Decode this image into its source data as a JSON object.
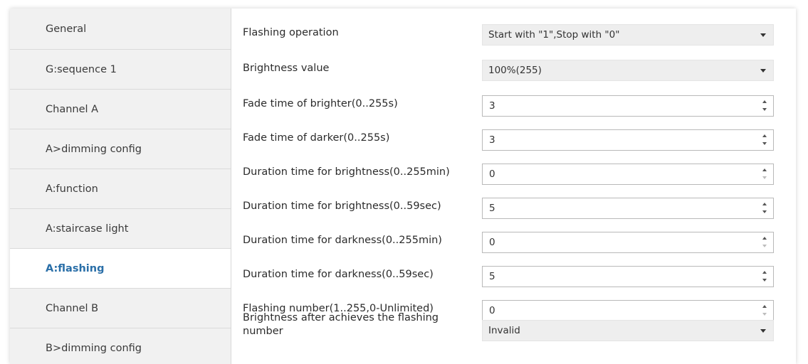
{
  "sidebar": {
    "items": [
      {
        "label": "General"
      },
      {
        "label": "G:sequence 1"
      },
      {
        "label": "Channel A"
      },
      {
        "label": "A>dimming config"
      },
      {
        "label": "A:function"
      },
      {
        "label": "A:staircase light"
      },
      {
        "label": "A:flashing",
        "active": true
      },
      {
        "label": "Channel B"
      },
      {
        "label": "B>dimming config"
      }
    ]
  },
  "params": [
    {
      "label": "Flashing operation",
      "control": "dropdown",
      "value": "Start with \"1\",Stop with \"0\""
    },
    {
      "label": "Brightness value",
      "control": "dropdown",
      "value": "100%(255)"
    },
    {
      "label": "Fade time of brighter(0..255s)",
      "control": "spinbox",
      "value": "3"
    },
    {
      "label": "Fade time of darker(0..255s)",
      "control": "spinbox",
      "value": "3"
    },
    {
      "label": "Duration time for brightness(0..255min)",
      "control": "spinbox",
      "value": "0"
    },
    {
      "label": "Duration time for brightness(0..59sec)",
      "control": "spinbox",
      "value": "5"
    },
    {
      "label": "Duration time for darkness(0..255min)",
      "control": "spinbox",
      "value": "0"
    },
    {
      "label": "Duration time for darkness(0..59sec)",
      "control": "spinbox",
      "value": "5"
    },
    {
      "label": "Flashing number(1..255,0-Unlimited)",
      "control": "spinbox",
      "value": "0"
    },
    {
      "label": "Brightness after achieves the flashing number",
      "control": "dropdown",
      "value": "Invalid"
    }
  ],
  "icons": {
    "dropdown": "chevron-down-icon",
    "spin_up": "spin-up-icon",
    "spin_down": "spin-down-icon"
  },
  "colors": {
    "active_nav_text": "#2a6fa8",
    "sidebar_bg": "#f1f1f1",
    "dropdown_bg": "#eeeeee"
  }
}
